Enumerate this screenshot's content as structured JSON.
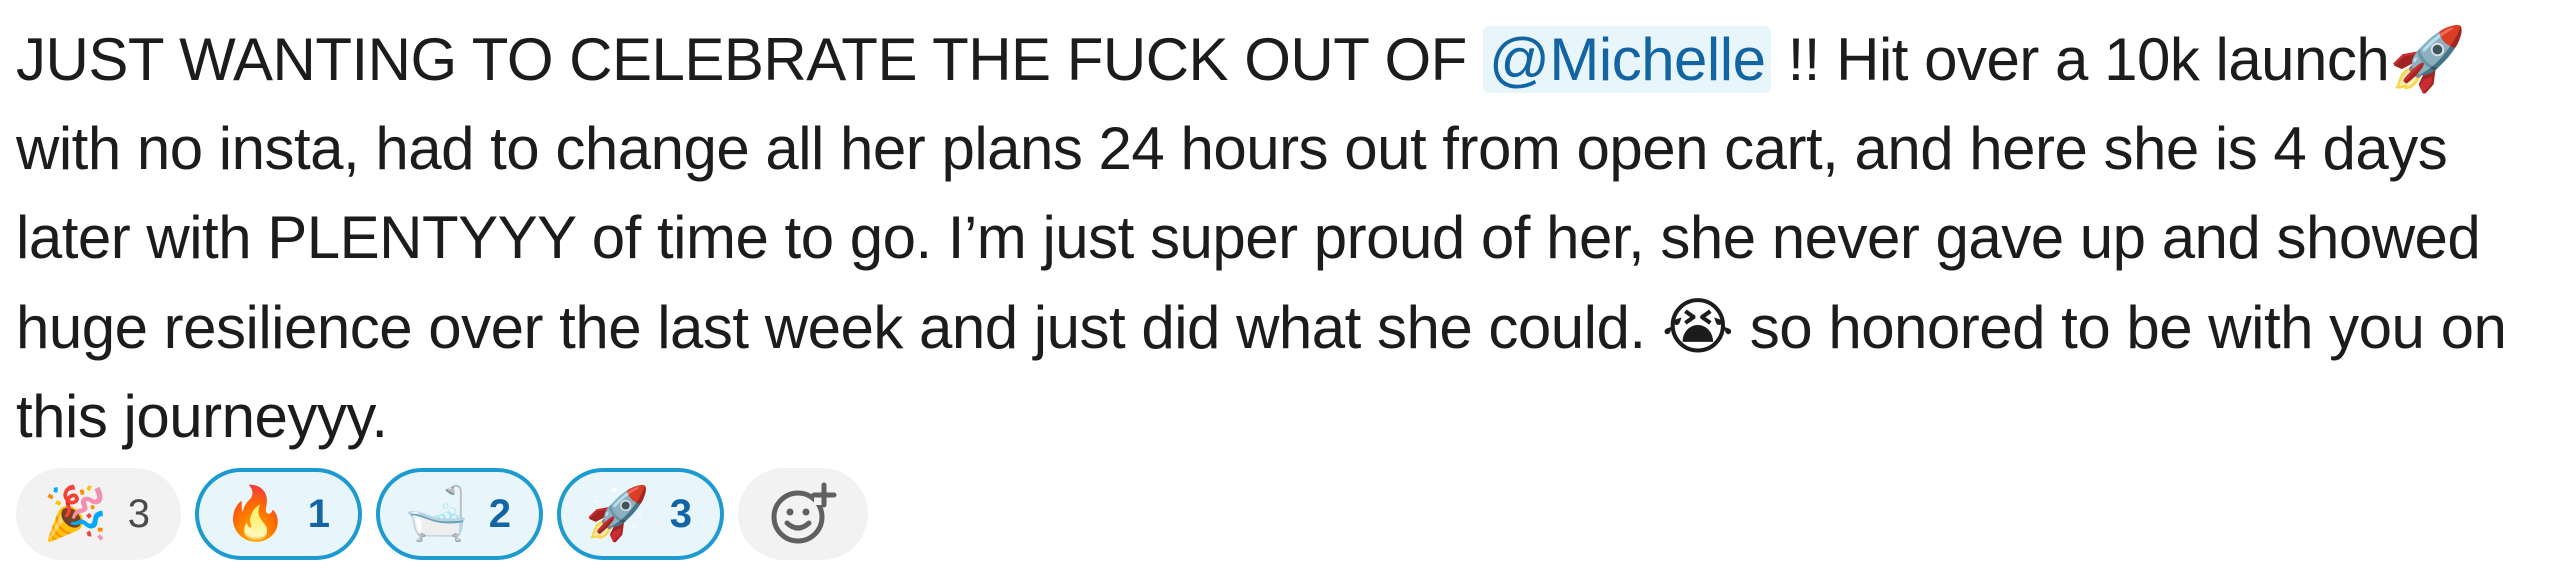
{
  "message": {
    "text_part1": "JUST WANTING TO CELEBRATE THE FUCK OUT OF ",
    "mention": "@Michelle",
    "text_part2": " !! Hit over a 10k launch",
    "emoji_rocket": "🚀",
    "text_part3": " with no insta, had to change all her plans 24 hours out from open cart, and here she is 4 days later with PLENTYYY of time to go. I’m just super proud of her, she never gave up and showed huge resilience over the last week and just did what she could. ",
    "emoji_crying": "😭",
    "text_part4": " so honored to be with you on this journeyyy."
  },
  "reactions": [
    {
      "emoji": "🎉",
      "icon": "party-popper-icon",
      "count": "3",
      "active": false
    },
    {
      "emoji": "🔥",
      "icon": "fire-icon",
      "count": "1",
      "active": true
    },
    {
      "emoji": "🛁",
      "icon": "bathtub-icon",
      "count": "2",
      "active": true
    },
    {
      "emoji": "🚀",
      "icon": "rocket-icon",
      "count": "3",
      "active": true
    }
  ],
  "add_reaction": {
    "icon": "add-reaction-icon"
  },
  "colors": {
    "mention_text": "#1264a3",
    "mention_bg": "#e8f5fa",
    "active_border": "#1d9bd1"
  }
}
